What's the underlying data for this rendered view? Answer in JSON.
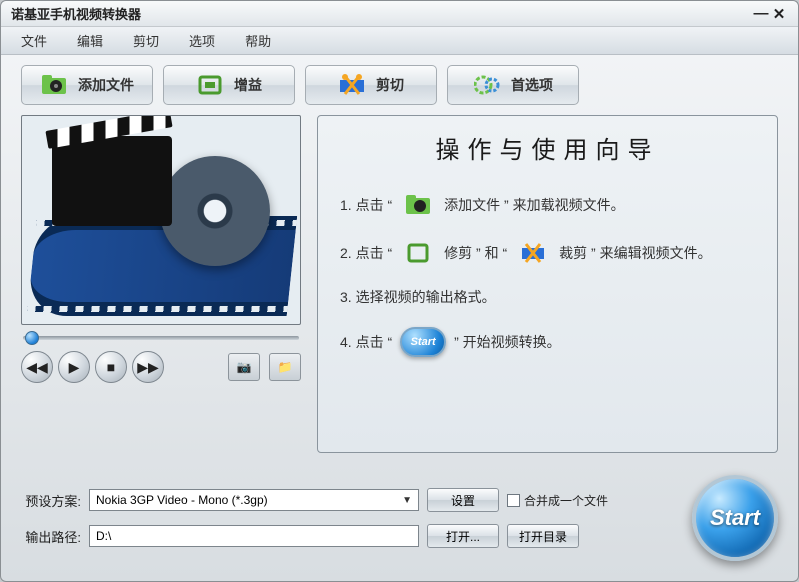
{
  "window": {
    "title": "诺基亚手机视频转换器"
  },
  "menu": {
    "file": "文件",
    "edit": "编辑",
    "cut": "剪切",
    "options": "选项",
    "help": "帮助"
  },
  "toolbar": {
    "add": "添加文件",
    "gain": "增益",
    "crop": "剪切",
    "prefs": "首选项"
  },
  "controls": {
    "prev": "◀◀",
    "play": "▶",
    "stop": "■",
    "next": "▶▶",
    "snapshot": "📷",
    "folder": "📁"
  },
  "guide": {
    "title": "操作与使用向导",
    "step1_a": "1.  点击 “",
    "step1_b": " 添加文件 ” 来加载视频文件。",
    "step2_a": "2.  点击 “",
    "step2_b": " 修剪  ”  和  “",
    "step2_c": " 裁剪 ” 来编辑视频文件。",
    "step3": "3.  选择视频的输出格式。",
    "step4_a": "4.  点击  “",
    "step4_b": "”  开始视频转换。",
    "start_pill": "Start"
  },
  "bottom": {
    "profile_label": "预设方案:",
    "profile_value": "Nokia 3GP Video - Mono (*.3gp)",
    "output_label": "输出路径:",
    "output_value": "D:\\",
    "settings_btn": "设置",
    "open_btn": "打开...",
    "open_dir_btn": "打开目录",
    "merge_label": "合并成一个文件",
    "start_big": "Start"
  }
}
